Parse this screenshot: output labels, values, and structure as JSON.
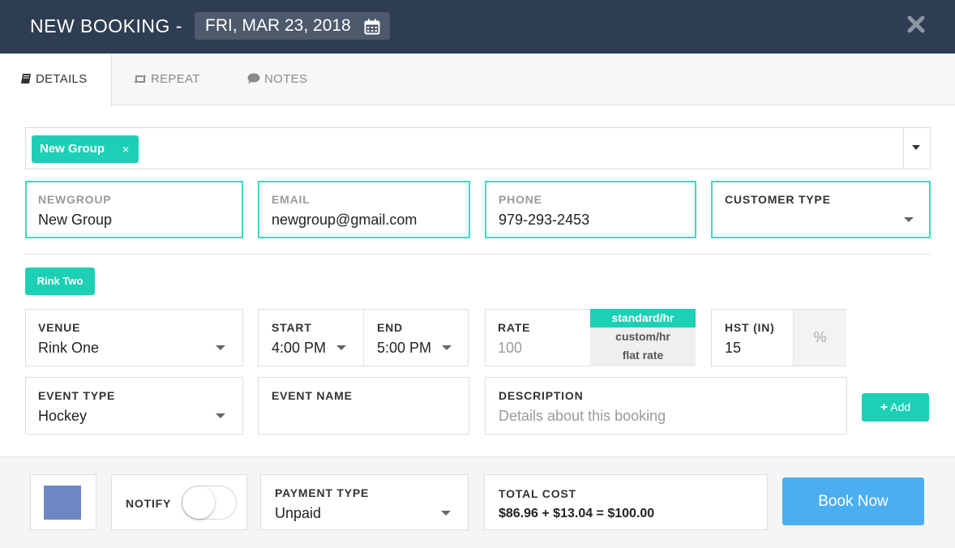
{
  "header": {
    "title": "NEW BOOKING -",
    "date": "FRI, MAR 23, 2018",
    "bg_color": "#2e3d52"
  },
  "tabs": [
    {
      "label": "DETAILS",
      "icon": "book-icon",
      "active": true
    },
    {
      "label": "REPEAT",
      "icon": "retweet-icon",
      "active": false
    },
    {
      "label": "NOTES",
      "icon": "comment-icon",
      "active": false
    }
  ],
  "customer_select": {
    "tag_label": "New Group",
    "tag_remove": "×"
  },
  "customer": {
    "name_label": "NEWGROUP",
    "name_value": "New Group",
    "email_label": "EMAIL",
    "email_value": "newgroup@gmail.com",
    "phone_label": "PHONE",
    "phone_value": "979-293-2453",
    "type_label": "CUSTOMER TYPE",
    "type_value": ""
  },
  "rink_tag": "Rink Two",
  "booking": {
    "venue_label": "VENUE",
    "venue_value": "Rink One",
    "start_label": "START",
    "start_value": "4:00 PM",
    "end_label": "END",
    "end_value": "5:00 PM",
    "rate_label": "RATE",
    "rate_value": "100",
    "rate_options": [
      "standard/hr",
      "custom/hr",
      "flat rate"
    ],
    "rate_selected": "standard/hr",
    "hst_label": "HST (IN)",
    "hst_value": "15",
    "hst_unit": "%",
    "event_type_label": "EVENT TYPE",
    "event_type_value": "Hockey",
    "event_name_label": "EVENT NAME",
    "event_name_value": "",
    "description_label": "DESCRIPTION",
    "description_placeholder": "Details about this booking",
    "add_label": "Add"
  },
  "footer": {
    "color_swatch": "#6c87c4",
    "notify_label": "NOTIFY",
    "notify_on": false,
    "payment_label": "PAYMENT TYPE",
    "payment_value": "Unpaid",
    "total_label": "TOTAL COST",
    "total_value": "$86.96 + $13.04 = $100.00",
    "book_label": "Book Now"
  },
  "colors": {
    "accent": "#1dcfb5",
    "primary_button": "#4aaef1"
  }
}
